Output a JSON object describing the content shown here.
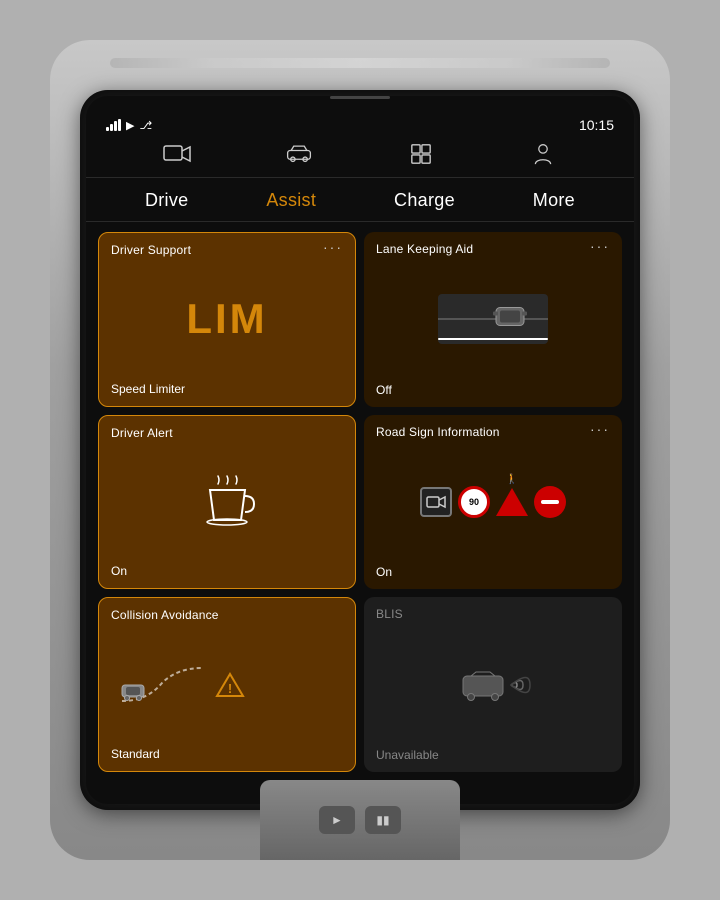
{
  "screen": {
    "time": "10:15",
    "status_icons": [
      "signal",
      "arrow",
      "bluetooth"
    ]
  },
  "top_nav": {
    "icons": [
      {
        "name": "camera-icon",
        "label": "Camera"
      },
      {
        "name": "car-icon",
        "label": "Car"
      },
      {
        "name": "grid-icon",
        "label": "Grid"
      },
      {
        "name": "person-icon",
        "label": "Person"
      }
    ]
  },
  "tabs": [
    {
      "label": "Drive",
      "active": false
    },
    {
      "label": "Assist",
      "active": true
    },
    {
      "label": "Charge",
      "active": false
    },
    {
      "label": "More",
      "active": false
    }
  ],
  "cards": [
    {
      "id": "driver-support",
      "title": "Driver Support",
      "has_menu": true,
      "content_type": "lim",
      "lim_text": "LIM",
      "footer": "Speed Limiter",
      "bordered": true,
      "unavailable": false
    },
    {
      "id": "lane-keeping",
      "title": "Lane Keeping Aid",
      "has_menu": true,
      "content_type": "lane",
      "footer": "Off",
      "bordered": false,
      "unavailable": false
    },
    {
      "id": "driver-alert",
      "title": "Driver Alert",
      "has_menu": false,
      "content_type": "coffee",
      "footer": "On",
      "bordered": true,
      "unavailable": false
    },
    {
      "id": "road-sign",
      "title": "Road Sign Information",
      "has_menu": true,
      "content_type": "signs",
      "footer": "On",
      "bordered": false,
      "unavailable": false
    },
    {
      "id": "collision",
      "title": "Collision Avoidance",
      "has_menu": false,
      "content_type": "collision",
      "footer": "Standard",
      "bordered": true,
      "unavailable": false
    },
    {
      "id": "blis",
      "title": "BLIS",
      "has_menu": false,
      "content_type": "blis",
      "footer": "Unavailable",
      "bordered": false,
      "unavailable": true
    }
  ],
  "colors": {
    "accent": "#d4870a",
    "card_bg": "#5c3200",
    "card_dark": "#2a1800",
    "unavailable_bg": "#1e1e1e",
    "screen_bg": "#0d0d0d"
  }
}
